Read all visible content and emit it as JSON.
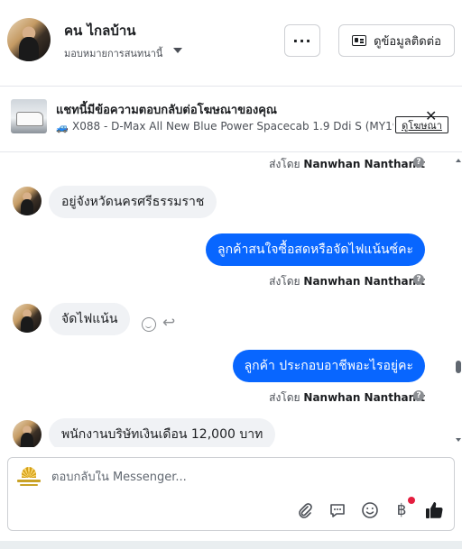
{
  "header": {
    "name": "คน ไกลบ้าน",
    "assign_label": "มอบหมายการสนทนานี้",
    "more_label": "···",
    "contact_label": "ดูข้อมูลติดต่อ"
  },
  "ad": {
    "title": "แชทนี้มีข้อความตอบกลับต่อโฆษณาของคุณ",
    "car_icon": "🚙",
    "description": "X088 - D-Max All New Blue Power Spacecab 1.9 Ddi S (MY19) ...",
    "close_label": "✕",
    "view_ad_label": "ดูโฆษณา"
  },
  "messages": {
    "sender_prefix": "ส่งโดย",
    "sender_name": "Nanwhan Nanthanit",
    "info_label": "?",
    "m1": "อยู่จังหวัดนครศรีธรรมราช",
    "m2": "ลูกค้าสนใจซื้อสดหรือจัดไฟแน้นซ์คะ",
    "m3": "จัดไฟแน้น",
    "m4": "ลูกค้า   ประกอบอาชีพอะไรอยู่คะ",
    "m5": "พนักงานบริษัทเงินเดือน 12,000 บาท"
  },
  "composer": {
    "placeholder": "ตอบกลับใน Messenger..."
  },
  "colors": {
    "accent": "#0866ff",
    "incoming_bubble": "#f0f2f5",
    "notification_dot": "#e41e3f"
  },
  "icons": [
    "caret-down-icon",
    "contact-card-icon",
    "close-icon",
    "info-icon",
    "smiley-icon",
    "reply-arrow-icon",
    "attachment-icon",
    "saved-reply-icon",
    "emoji-icon",
    "baht-icon",
    "thumbs-up-icon"
  ]
}
